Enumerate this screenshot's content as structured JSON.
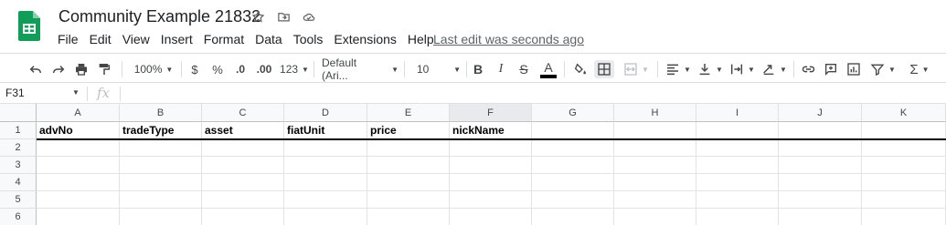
{
  "doc": {
    "title": "Community Example 21832",
    "last_edit": "Last edit was seconds ago"
  },
  "menu": [
    "File",
    "Edit",
    "View",
    "Insert",
    "Format",
    "Data",
    "Tools",
    "Extensions",
    "Help"
  ],
  "toolbar": {
    "zoom": "100%",
    "currency": "$",
    "percent": "%",
    "dec_decrease": ".0",
    "dec_increase": ".00",
    "more_formats": "123",
    "font": "Default (Ari...",
    "font_size": "10",
    "bold": "B",
    "italic": "I",
    "strike": "S",
    "text_color": "A",
    "sum": "Σ"
  },
  "formula_bar": {
    "name_box": "F31",
    "fx": "fx"
  },
  "columns": [
    "A",
    "B",
    "C",
    "D",
    "E",
    "F",
    "G",
    "H",
    "I",
    "J",
    "K"
  ],
  "selected_column": "F",
  "rows": [
    "1",
    "2",
    "3",
    "4",
    "5",
    "6"
  ],
  "header_row": [
    "advNo",
    "tradeType",
    "asset",
    "fiatUnit",
    "price",
    "nickName"
  ],
  "colors": {
    "logo_green": "#0f9d58",
    "gridline": "#e2e3e3",
    "header_bg": "#f8f9fa"
  }
}
